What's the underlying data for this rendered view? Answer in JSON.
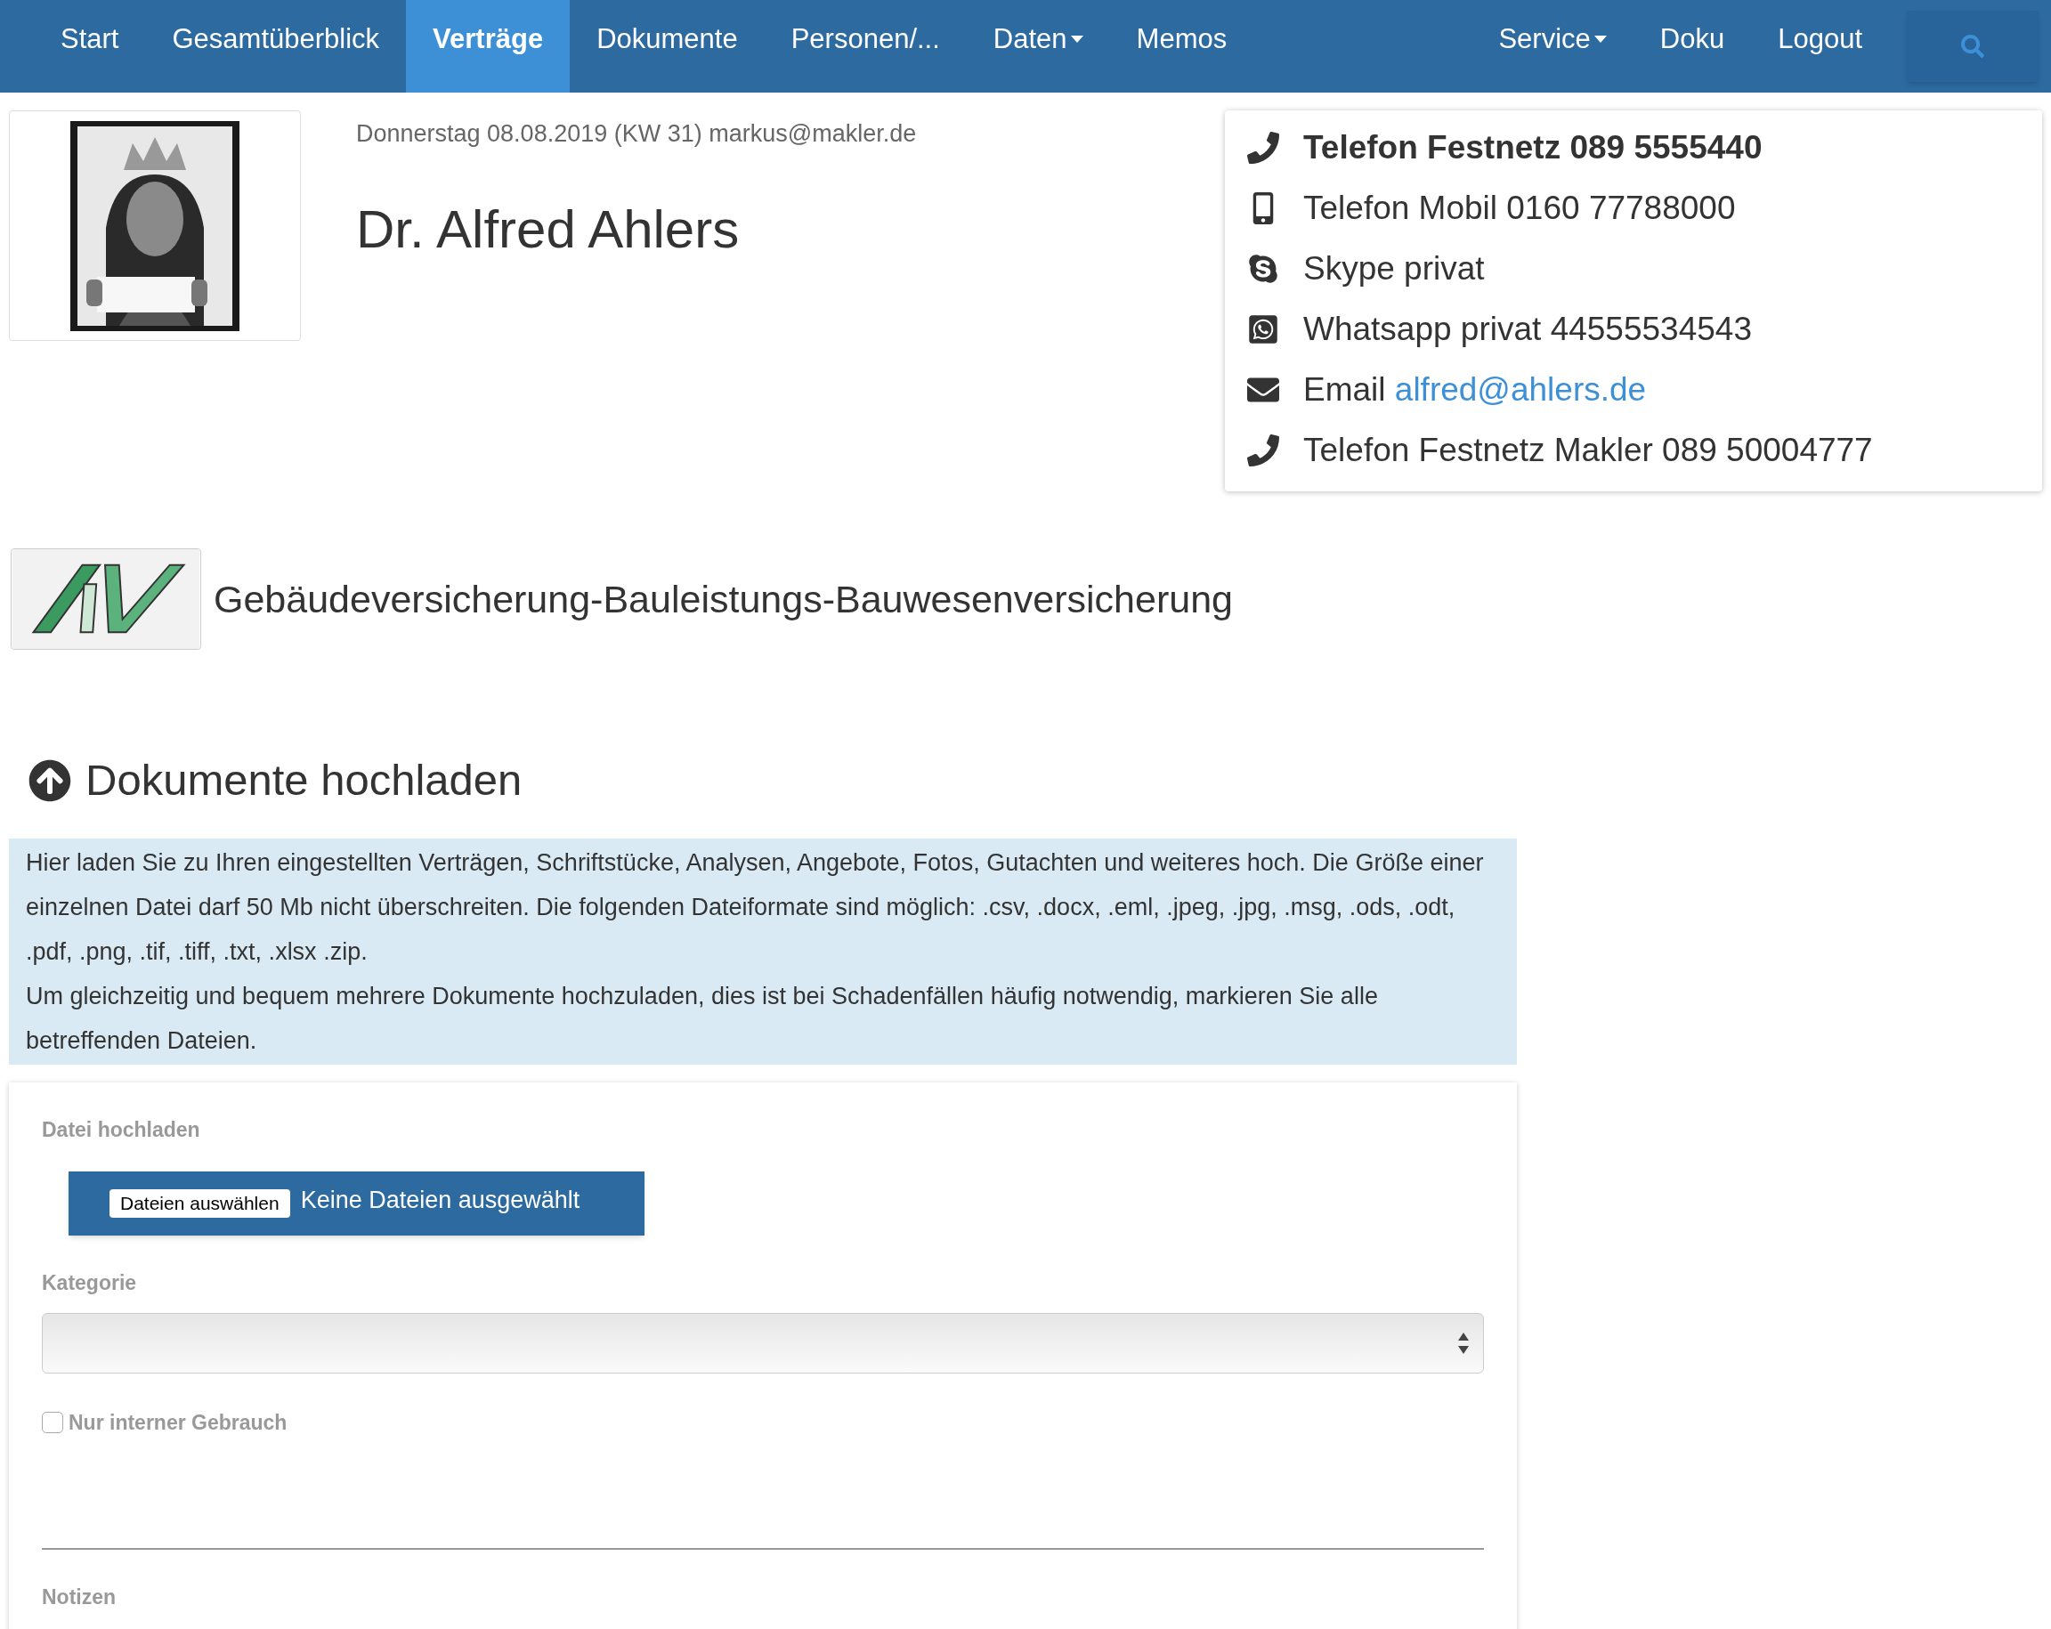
{
  "nav": {
    "left": [
      {
        "label": "Start",
        "kind": "link",
        "selected": false
      },
      {
        "label": "Gesamtüberblick",
        "kind": "link",
        "selected": false
      },
      {
        "label": "Verträge",
        "kind": "link",
        "selected": true
      },
      {
        "label": "Dokumente",
        "kind": "link",
        "selected": false
      },
      {
        "label": "Personen/...",
        "kind": "link",
        "selected": false
      },
      {
        "label": "Daten",
        "kind": "dropdown",
        "selected": false
      },
      {
        "label": "Memos",
        "kind": "link",
        "selected": false
      }
    ],
    "right": [
      {
        "label": "Service",
        "kind": "dropdown",
        "selected": false
      },
      {
        "label": "Doku",
        "kind": "link",
        "selected": false
      },
      {
        "label": "Logout",
        "kind": "link",
        "selected": false
      }
    ]
  },
  "header": {
    "date_line": "Donnerstag 08.08.2019 (KW 31) markus@makler.de",
    "name": "Dr. Alfred Ahlers"
  },
  "contacts": [
    {
      "kind": "phone",
      "text": "Telefon Festnetz 089 5555440",
      "emphasized": true
    },
    {
      "kind": "mobile",
      "text": "Telefon Mobil 0160 77788000",
      "emphasized": false
    },
    {
      "kind": "skype",
      "text": "Skype privat",
      "emphasized": false
    },
    {
      "kind": "whatsapp",
      "text": "Whatsapp privat 44555534543",
      "emphasized": false
    },
    {
      "kind": "email",
      "text": "Email",
      "link": "alfred@ahlers.de",
      "emphasized": false
    },
    {
      "kind": "phone",
      "text": "Telefon Festnetz Makler 089 50004777",
      "emphasized": false
    }
  ],
  "contract": {
    "title": "Gebäudeversicherung-Bauleistungs-Bauwesenversicherung"
  },
  "upload": {
    "heading": "Dokumente hochladen",
    "info": [
      "Hier laden Sie zu Ihren eingestellten Verträgen, Schriftstücke, Analysen, Angebote, Fotos, Gutachten und weiteres hoch. Die Größe einer einzelnen Datei darf 50 Mb nicht überschreiten. Die folgenden Dateiformate sind möglich: .csv, .docx, .eml, .jpeg, .jpg, .msg, .ods, .odt, .pdf, .png, .tif, .tiff, .txt, .xlsx .zip.",
      "Um gleichzeitig und bequem mehrere Dokumente hochzuladen, dies ist bei Schadenfällen häufig notwendig, markieren Sie alle betreffenden Dateien."
    ],
    "file_label": "Datei hochladen",
    "file_button": "Dateien auswählen",
    "file_status": "Keine Dateien ausgewählt",
    "category_label": "Kategorie",
    "internal": {
      "label": "Nur interner Gebrauch",
      "checked": false
    },
    "notes_label": "Notizen"
  }
}
